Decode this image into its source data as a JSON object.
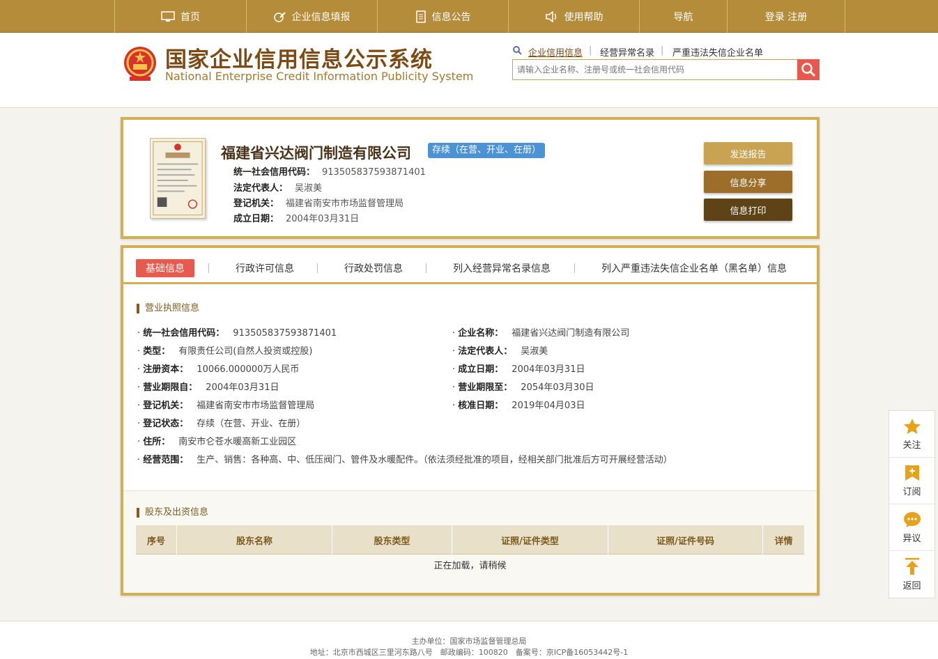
{
  "topnav": {
    "items": [
      {
        "label": "首页",
        "icon": "monitor-icon"
      },
      {
        "label": "企业信息填报",
        "icon": "edit-icon"
      },
      {
        "label": "信息公告",
        "icon": "document-icon"
      },
      {
        "label": "使用帮助",
        "icon": "speaker-icon"
      },
      {
        "label": "导航",
        "icon": ""
      },
      {
        "label": "登录 注册",
        "icon": ""
      }
    ]
  },
  "header": {
    "title_cn": "国家企业信用信息公示系统",
    "title_en": "National Enterprise Credit Information Publicity System",
    "links": [
      "企业信用信息",
      "经营异常名录",
      "严重违法失信企业名单"
    ],
    "separator": "|",
    "search_placeholder": "请输入企业名称、注册号或统一社会信用代码"
  },
  "company": {
    "name": "福建省兴达阀门制造有限公司",
    "status": "存续（在营、开业、在册）",
    "fields": [
      {
        "label": "统一社会信用代码：",
        "value": "913505837593871401"
      },
      {
        "label": "法定代表人：",
        "value": "吴淑美"
      },
      {
        "label": "登记机关：",
        "value": "福建省南安市市场监督管理局"
      },
      {
        "label": "成立日期：",
        "value": "2004年03月31日"
      }
    ],
    "actions": [
      "发送报告",
      "信息分享",
      "信息打印"
    ]
  },
  "tabs": [
    "基础信息",
    "行政许可信息",
    "行政处罚信息",
    "列入经营异常名录信息",
    "列入严重违法失信企业名单（黑名单）信息"
  ],
  "license": {
    "title": "营业执照信息",
    "left": [
      {
        "label": "统一社会信用代码：",
        "value": "913505837593871401"
      },
      {
        "label": "类型：",
        "value": "有限责任公司(自然人投资或控股)"
      },
      {
        "label": "注册资本：",
        "value": "10066.000000万人民币"
      },
      {
        "label": "营业期限自：",
        "value": "2004年03月31日"
      },
      {
        "label": "登记机关：",
        "value": "福建省南安市市场监督管理局"
      },
      {
        "label": "登记状态：",
        "value": "存续（在营、开业、在册）"
      },
      {
        "label": "住所：",
        "value": "南安市仑苍水暖高新工业园区"
      },
      {
        "label": "经营范围：",
        "value": "生产、销售：各种高、中、低压阀门、管件及水暖配件。（依法须经批准的项目，经相关部门批准后方可开展经营活动）"
      }
    ],
    "right": [
      {
        "label": "企业名称：",
        "value": "福建省兴达阀门制造有限公司"
      },
      {
        "label": "法定代表人：",
        "value": "吴淑美"
      },
      {
        "label": "成立日期：",
        "value": "2004年03月31日"
      },
      {
        "label": "营业期限至：",
        "value": "2054年03月30日"
      },
      {
        "label": "核准日期：",
        "value": "2019年04月03日"
      }
    ],
    "bullet": "·"
  },
  "shareholders": {
    "title": "股东及出资信息",
    "columns": [
      "序号",
      "股东名称",
      "股东类型",
      "证照/证件类型",
      "证照/证件号码",
      "详情"
    ],
    "loading": "正在加载，请稍候"
  },
  "sidefloat": [
    "关注",
    "订阅",
    "异议",
    "返回"
  ],
  "footer": {
    "line1": "主办单位：国家市场监督管理总局",
    "line2": "地址：北京市西城区三里河东路八号　邮政编码：100820　备案号：京ICP备16053442号-1"
  },
  "colors": {
    "gold": "#b58c3a",
    "border": "#d4ae52",
    "red": "#e75b4f",
    "blue": "#4c93d6"
  }
}
